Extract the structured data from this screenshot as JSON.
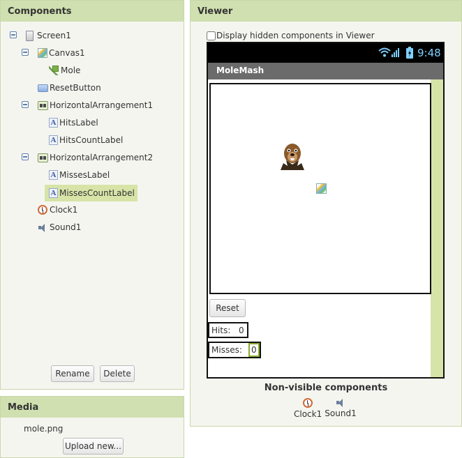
{
  "components_panel": {
    "title": "Components",
    "tree": [
      {
        "label": "Screen1",
        "icon": "screen-icon"
      },
      {
        "label": "Canvas1",
        "icon": "canvas-icon"
      },
      {
        "label": "Mole",
        "icon": "image-sprite-icon"
      },
      {
        "label": "ResetButton",
        "icon": "button-icon"
      },
      {
        "label": "HorizontalArrangement1",
        "icon": "horizontal-arrangement-icon"
      },
      {
        "label": "HitsLabel",
        "icon": "label-icon"
      },
      {
        "label": "HitsCountLabel",
        "icon": "label-icon"
      },
      {
        "label": "HorizontalArrangement2",
        "icon": "horizontal-arrangement-icon"
      },
      {
        "label": "MissesLabel",
        "icon": "label-icon"
      },
      {
        "label": "MissesCountLabel",
        "icon": "label-icon",
        "selected": true
      },
      {
        "label": "Clock1",
        "icon": "clock-icon"
      },
      {
        "label": "Sound1",
        "icon": "sound-icon"
      }
    ],
    "rename_button": "Rename",
    "delete_button": "Delete"
  },
  "media_panel": {
    "title": "Media",
    "files": [
      "mole.png"
    ],
    "upload_button": "Upload new..."
  },
  "viewer_panel": {
    "title": "Viewer",
    "show_hidden_label": "Display hidden components in Viewer",
    "show_hidden_checked": false,
    "status_time": "9:48",
    "app_title": "MoleMash",
    "reset_button": "Reset",
    "hits_label": "Hits:",
    "hits_value": "0",
    "misses_label": "Misses:",
    "misses_value": "0",
    "non_visible_title": "Non-visible components",
    "non_visible": [
      {
        "label": "Clock1",
        "icon": "clock-icon"
      },
      {
        "label": "Sound1",
        "icon": "sound-icon"
      }
    ]
  },
  "colors": {
    "header_bg": "#d0e0b0",
    "selection_bg": "#d6e4a8",
    "status_bar_bg": "#000000",
    "status_icon": "#7fd0ff",
    "title_bar_bg": "#6b6b6b",
    "selected_component_border": "#8aa830"
  }
}
